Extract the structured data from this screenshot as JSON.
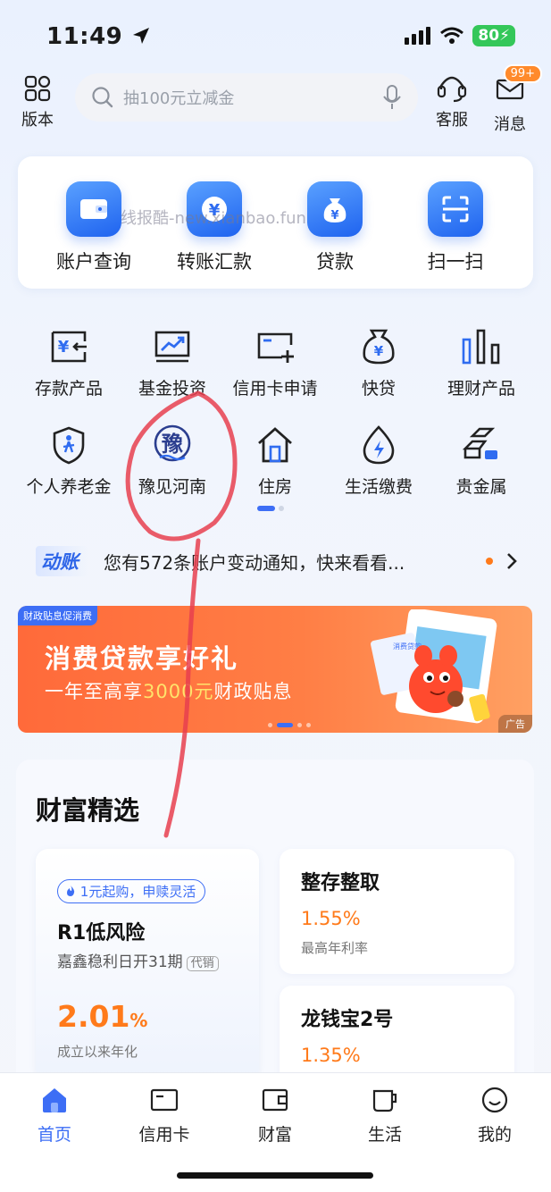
{
  "status": {
    "time": "11:49",
    "battery": "80"
  },
  "top": {
    "version_label": "版本",
    "search_placeholder": "抽100元立减金",
    "service_label": "客服",
    "messages_label": "消息",
    "messages_badge": "99+"
  },
  "quick": [
    {
      "label": "账户查询",
      "icon": "wallet-icon"
    },
    {
      "label": "转账汇款",
      "icon": "yen-transfer-icon"
    },
    {
      "label": "贷款",
      "icon": "money-bag-icon"
    },
    {
      "label": "扫一扫",
      "icon": "scan-icon"
    }
  ],
  "watermark": "线报酷-new.xianbao.fun",
  "grid": [
    {
      "label": "存款产品",
      "icon": "deposit-icon"
    },
    {
      "label": "基金投资",
      "icon": "fund-chart-icon"
    },
    {
      "label": "信用卡申请",
      "icon": "credit-card-add-icon"
    },
    {
      "label": "快贷",
      "icon": "quick-loan-bag-icon"
    },
    {
      "label": "理财产品",
      "icon": "bar-chart-icon"
    },
    {
      "label": "个人养老金",
      "icon": "pension-shield-icon"
    },
    {
      "label": "豫见河南",
      "icon": "yu-henan-icon"
    },
    {
      "label": "住房",
      "icon": "house-icon"
    },
    {
      "label": "生活缴费",
      "icon": "utility-drop-icon"
    },
    {
      "label": "贵金属",
      "icon": "gold-bar-icon"
    }
  ],
  "notice": {
    "tag": "动账",
    "text": "您有572条账户变动通知，快来看看..."
  },
  "banner": {
    "tag": "财政贴息促消费",
    "title": "消费贷款享好礼",
    "sub_prefix": "一年至高享",
    "sub_highlight": "3000元",
    "sub_suffix": "财政贴息",
    "ad": "广告",
    "card_text": "消费贷款"
  },
  "wealth": {
    "title": "财富精选",
    "featured": {
      "pill": "1元起购，申赎灵活",
      "risk": "R1低风险",
      "name": "嘉鑫稳利日开31期",
      "tag": "代销",
      "rate": "2.01",
      "rate_unit": "%",
      "rate_label": "成立以来年化"
    },
    "products": [
      {
        "title": "整存整取",
        "rate": "1.55%",
        "label": "最高年利率"
      },
      {
        "title": "龙钱宝2号",
        "rate": "1.35%",
        "label": ""
      }
    ]
  },
  "tabs": [
    {
      "label": "首页",
      "icon": "home-icon",
      "active": true
    },
    {
      "label": "信用卡",
      "icon": "card-icon"
    },
    {
      "label": "财富",
      "icon": "wallet-tab-icon"
    },
    {
      "label": "生活",
      "icon": "cup-icon"
    },
    {
      "label": "我的",
      "icon": "smile-icon"
    }
  ],
  "colors": {
    "brand": "#3d6ef5",
    "accent": "#ff7a1a",
    "annotation": "#e8404f"
  }
}
